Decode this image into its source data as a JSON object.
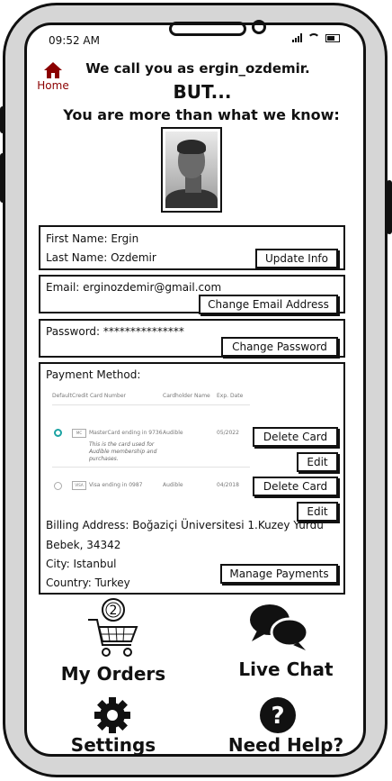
{
  "status": {
    "time": "09:52 AM"
  },
  "nav": {
    "home_label": "Home"
  },
  "greeting": {
    "line1": "We call you as ergin_ozdemir.",
    "line2": "BUT...",
    "line3": "You are more than what we know:"
  },
  "profile": {
    "first_name": "First Name: Ergin",
    "last_name": "Last Name: Ozdemir",
    "update_label": "Update Info",
    "email": "Email: erginozdemir@gmail.com",
    "change_email_label": "Change Email Address",
    "password": "Password: ***************",
    "change_password_label": "Change Password"
  },
  "payment": {
    "title": "Payment Method:",
    "headers": [
      "Default",
      "Credit Card Number",
      "Cardholder Name",
      "Exp. Date"
    ],
    "cards": [
      {
        "brand": "MC",
        "number": "MasterCard ending in 9736",
        "note": "This is the card used for Audible membership and purchases.",
        "holder": "Audible",
        "exp": "05/2022",
        "default": true
      },
      {
        "brand": "VISA",
        "number": "Visa ending in 0987",
        "note": "",
        "holder": "Audible",
        "exp": "04/2018",
        "default": false
      }
    ],
    "delete_label": "Delete Card",
    "edit_label": "Edit",
    "billing_line1": "Billing Address: Boğaziçi Üniversitesi 1.Kuzey Yurdu",
    "billing_line2": "Bebek, 34342",
    "city": "City: Istanbul",
    "country": "Country: Turkey",
    "manage_label": "Manage Payments"
  },
  "bottom_nav": {
    "orders": "My Orders",
    "orders_badge": "2",
    "chat": "Live Chat",
    "settings": "Settings",
    "help": "Need Help?"
  }
}
